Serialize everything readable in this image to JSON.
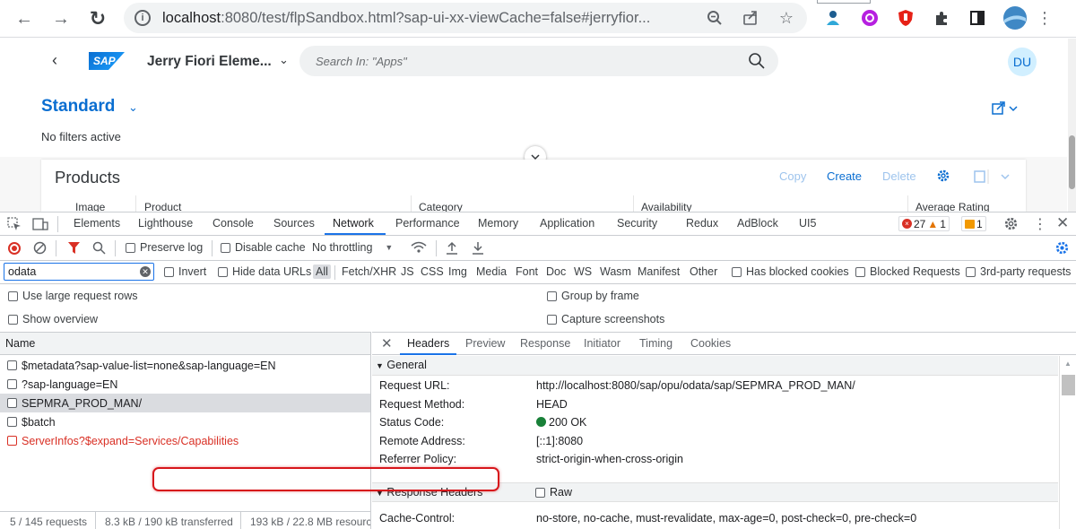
{
  "browser": {
    "url_host": "localhost",
    "url_rest": ":8080/test/flpSandbox.html?sap-ui-xx-viewCache=false#jerryfior...",
    "nav_back": "←",
    "nav_forward": "→",
    "nav_reload": "↻"
  },
  "shell": {
    "logo_text": "SAP",
    "app_title": "Jerry Fiori Eleme...",
    "search_placeholder": "Search In: \"Apps\"",
    "avatar_initials": "DU"
  },
  "page": {
    "variant_title": "Standard",
    "filter_status": "No filters active"
  },
  "table": {
    "title": "Products",
    "copy_label": "Copy",
    "create_label": "Create",
    "delete_label": "Delete",
    "columns": [
      "Image",
      "Product",
      "Category",
      "Availability",
      "Average Rating"
    ]
  },
  "devtools": {
    "tabs": [
      "Elements",
      "Lighthouse",
      "Console",
      "Sources",
      "Network",
      "Performance",
      "Memory",
      "Application",
      "Security",
      "Redux",
      "AdBlock",
      "UI5"
    ],
    "active_tab": "Network",
    "errors_count": "27",
    "warnings_count": "1",
    "info_count": "1",
    "toolbar": {
      "preserve_log": "Preserve log",
      "disable_cache": "Disable cache",
      "throttling": "No throttling"
    },
    "filter": {
      "value": "odata",
      "invert": "Invert",
      "hide_data_urls": "Hide data URLs",
      "types": [
        "All",
        "Fetch/XHR",
        "JS",
        "CSS",
        "Img",
        "Media",
        "Font",
        "Doc",
        "WS",
        "Wasm",
        "Manifest",
        "Other"
      ],
      "has_blocked_cookies": "Has blocked cookies",
      "blocked_requests": "Blocked Requests",
      "third_party": "3rd-party requests"
    },
    "options": {
      "large_rows": "Use large request rows",
      "show_overview": "Show overview",
      "group_by_frame": "Group by frame",
      "capture_screenshots": "Capture screenshots"
    },
    "requests": {
      "header": "Name",
      "items": [
        {
          "name": "$metadata?sap-value-list=none&sap-language=EN",
          "state": "normal"
        },
        {
          "name": "?sap-language=EN",
          "state": "normal"
        },
        {
          "name": "SEPMRA_PROD_MAN/",
          "state": "selected"
        },
        {
          "name": "$batch",
          "state": "normal"
        },
        {
          "name": "ServerInfos?$expand=Services/Capabilities",
          "state": "error"
        }
      ],
      "status_requests": "5 / 145 requests",
      "status_transferred": "8.3 kB / 190 kB transferred",
      "status_resources": "193 kB / 22.8 MB resources"
    },
    "detail": {
      "tabs": [
        "Headers",
        "Preview",
        "Response",
        "Initiator",
        "Timing",
        "Cookies"
      ],
      "active_tab": "Headers",
      "general_title": "General",
      "general": [
        {
          "key": "Request URL:",
          "value": "http://localhost:8080/sap/opu/odata/sap/SEPMRA_PROD_MAN/"
        },
        {
          "key": "Request Method:",
          "value": "HEAD"
        },
        {
          "key": "Status Code:",
          "value": "200 OK"
        },
        {
          "key": "Remote Address:",
          "value": "[::1]:8080"
        },
        {
          "key": "Referrer Policy:",
          "value": "strict-origin-when-cross-origin"
        }
      ],
      "response_title": "Response Headers",
      "raw_label": "Raw",
      "response": [
        {
          "key": "Cache-Control:",
          "value": "no-store, no-cache, must-revalidate, max-age=0, post-check=0, pre-check=0"
        }
      ]
    }
  },
  "colors": {
    "fiori_blue": "#0a6ed1",
    "devtools_blue": "#1a73e8",
    "error_red": "#d93025",
    "highlight_red": "#d7161b",
    "status_green": "#188038"
  }
}
